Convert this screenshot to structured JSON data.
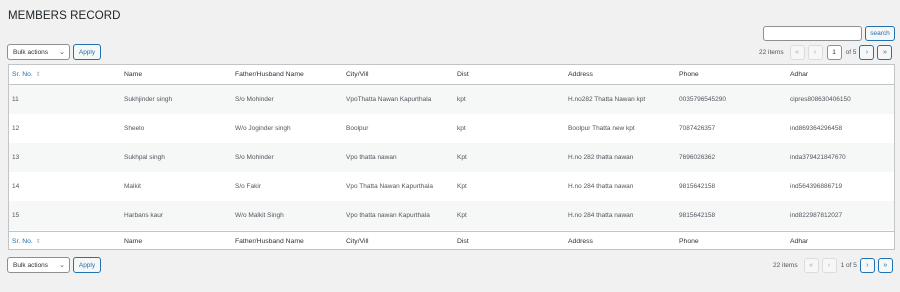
{
  "page": {
    "title": "MEMBERS RECORD"
  },
  "search": {
    "button_label": "search",
    "value": ""
  },
  "top_nav": {
    "bulk_label": "Bulk actions",
    "apply_label": "Apply",
    "items_count": "22 items",
    "first": "«",
    "prev": "‹",
    "current_page": "1",
    "of_total": "of 5",
    "next": "›",
    "last": "»"
  },
  "bottom_nav": {
    "bulk_label": "Bulk actions",
    "apply_label": "Apply",
    "items_count": "22 items",
    "first": "«",
    "prev": "‹",
    "current_page_text": "1 of 5",
    "next": "›",
    "last": "»"
  },
  "table": {
    "columns": [
      "Sr. No.",
      "Name",
      "Father/Husband Name",
      "City/Vill",
      "Dist",
      "Address",
      "Phone",
      "Adhar"
    ],
    "rows": [
      [
        "11",
        "Sukhjinder singh",
        "S/o Mohinder",
        "VpoThatta Nawan Kapurthala",
        "kpt",
        "H.no282 Thatta Nawan kpt",
        "0035796545290",
        "cipres808630406150"
      ],
      [
        "12",
        "Sheelo",
        "W/o Joginder singh",
        "Boolpur",
        "kpt",
        "Boolpur Thatta new kpt",
        "7087426357",
        "ind869364296458"
      ],
      [
        "13",
        "Sukhpal singh",
        "S/o Mohinder",
        "Vpo thatta nawan",
        "Kpt",
        "H.no 282 thatta nawan",
        "7696026362",
        "inda379421847670"
      ],
      [
        "14",
        "Malkit",
        "S/o Fakir",
        "Vpo Thatta Nawan Kapurthala",
        "Kpt",
        "H.no 284 thatta nawan",
        "9815642158",
        "ind564396886719"
      ],
      [
        "15",
        "Harbans kaur",
        "W/o Malkit Singh",
        "Vpo thatta nawan Kapurthala",
        "Kpt",
        "H.no 284 thatta nawan",
        "9815642158",
        "ind822987812027"
      ]
    ]
  },
  "icons": {
    "sort": "sort-arrows-icon",
    "dropdown": "chevron-down-icon"
  },
  "colors": {
    "accent": "#2271b1",
    "background": "#f1f1f1",
    "stripe": "#f6f7f7"
  }
}
